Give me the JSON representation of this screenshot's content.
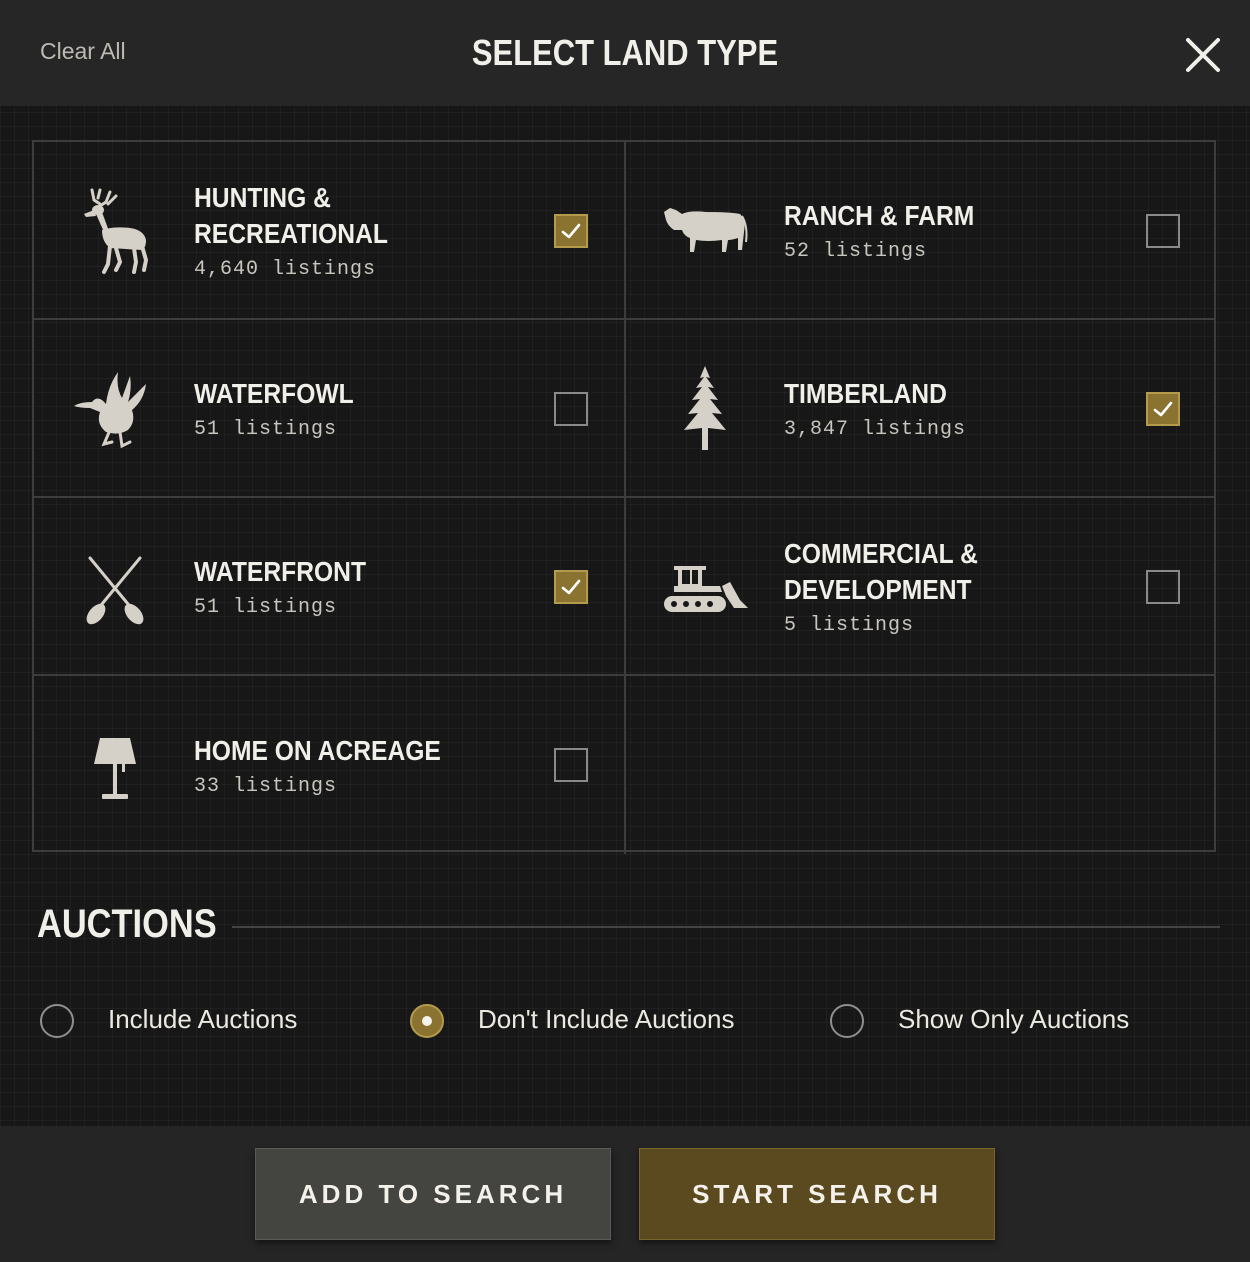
{
  "header": {
    "clear_all": "Clear All",
    "title": "SELECT LAND TYPE",
    "close_icon": "close-icon"
  },
  "colors": {
    "accent": "#8a7330",
    "background": "#171717",
    "header_bg": "#262626"
  },
  "land_types": [
    {
      "line1": "HUNTING &",
      "line2": "RECREATIONAL",
      "count": "4,640 listings",
      "icon": "deer-icon",
      "checked": true
    },
    {
      "line1": "RANCH & FARM",
      "line2": "",
      "count": "52 listings",
      "icon": "cow-icon",
      "checked": false
    },
    {
      "line1": "WATERFOWL",
      "line2": "",
      "count": "51 listings",
      "icon": "duck-icon",
      "checked": false
    },
    {
      "line1": "TIMBERLAND",
      "line2": "",
      "count": "3,847 listings",
      "icon": "pine-tree-icon",
      "checked": true
    },
    {
      "line1": "WATERFRONT",
      "line2": "",
      "count": "51 listings",
      "icon": "crossed-paddles-icon",
      "checked": true
    },
    {
      "line1": "COMMERCIAL &",
      "line2": "DEVELOPMENT",
      "count": "5 listings",
      "icon": "bulldozer-icon",
      "checked": false
    },
    {
      "line1": "HOME ON ACREAGE",
      "line2": "",
      "count": "33 listings",
      "icon": "lamp-icon",
      "checked": false
    }
  ],
  "auctions": {
    "title": "AUCTIONS",
    "options": [
      {
        "label": "Include Auctions",
        "selected": false
      },
      {
        "label": "Don't Include Auctions",
        "selected": true
      },
      {
        "label": "Show Only Auctions",
        "selected": false
      }
    ]
  },
  "footer": {
    "add_label": "ADD TO SEARCH",
    "start_label": "START SEARCH"
  }
}
